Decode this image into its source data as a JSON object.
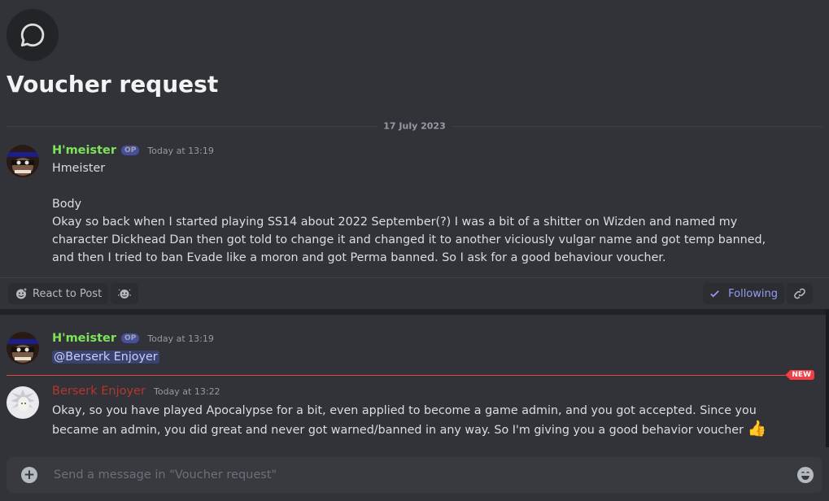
{
  "thread": {
    "title": "Voucher request"
  },
  "date_divider": "17 July 2023",
  "messages": [
    {
      "author": "H'meister",
      "author_color": "#7fe35a",
      "badge": "OP",
      "time": "Today at 13:19",
      "lines": [
        "Hmeister",
        "",
        "Body",
        "Okay so back when I started playing SS14 about 2022 September(?) I was a bit of a shitter on Wizden and named my character Dickhead Dan then got told to change it and changed it to another viciously vulgar name and got temp banned, and then I tried to ban Evade like a moron and got Perma banned. So I ask for a good behaviour voucher."
      ]
    },
    {
      "author": "H'meister",
      "author_color": "#7fe35a",
      "badge": "OP",
      "time": "Today at 13:19",
      "mention": "@Berserk Enjoyer"
    },
    {
      "author": "Berserk Enjoyer",
      "author_color": "#b7352f",
      "time": "Today at 13:22",
      "text": "Okay, so you have played Apocalypse for a bit, even applied to become a game admin, and you got accepted. Since you became an admin, you did great and never got warned/banned in any way. So I'm giving you a good behavior voucher",
      "emoji": "👍"
    }
  ],
  "actions": {
    "react_label": "React to Post",
    "following_label": "Following"
  },
  "new_badge": "NEW",
  "composer": {
    "placeholder": "Send a message in \"Voucher request\""
  },
  "colors": {
    "accent": "#5865f2",
    "following": "#949cf7",
    "new": "#f23f43"
  }
}
